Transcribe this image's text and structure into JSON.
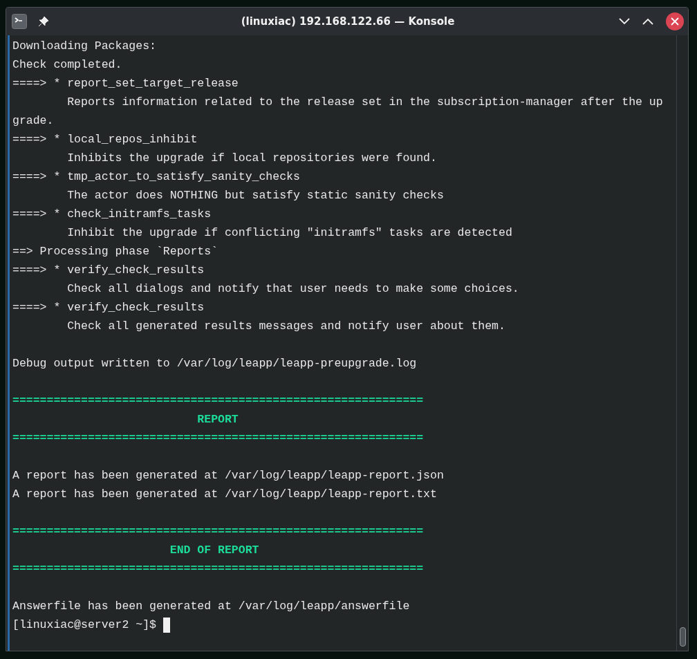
{
  "window": {
    "title": "(linuxiac) 192.168.122.66 — Konsole"
  },
  "lines": [
    {
      "kind": "output",
      "text": "Downloading Packages:"
    },
    {
      "kind": "output",
      "text": "Check completed."
    },
    {
      "kind": "output",
      "text": "====> * report_set_target_release"
    },
    {
      "kind": "output",
      "text": "        Reports information related to the release set in the subscription-manager after the up"
    },
    {
      "kind": "output",
      "text": "grade."
    },
    {
      "kind": "output",
      "text": "====> * local_repos_inhibit"
    },
    {
      "kind": "output",
      "text": "        Inhibits the upgrade if local repositories were found."
    },
    {
      "kind": "output",
      "text": "====> * tmp_actor_to_satisfy_sanity_checks"
    },
    {
      "kind": "output",
      "text": "        The actor does NOTHING but satisfy static sanity checks"
    },
    {
      "kind": "output",
      "text": "====> * check_initramfs_tasks"
    },
    {
      "kind": "output",
      "text": "        Inhibit the upgrade if conflicting \"initramfs\" tasks are detected"
    },
    {
      "kind": "output",
      "text": "==> Processing phase `Reports`"
    },
    {
      "kind": "output",
      "text": "====> * verify_check_results"
    },
    {
      "kind": "output",
      "text": "        Check all dialogs and notify that user needs to make some choices."
    },
    {
      "kind": "output",
      "text": "====> * verify_check_results"
    },
    {
      "kind": "output",
      "text": "        Check all generated results messages and notify user about them."
    },
    {
      "kind": "blank"
    },
    {
      "kind": "output",
      "text": "Debug output written to /var/log/leapp/leapp-preupgrade.log"
    },
    {
      "kind": "blank"
    },
    {
      "kind": "highlight",
      "text": "============================================================"
    },
    {
      "kind": "highlight",
      "text": "                           REPORT"
    },
    {
      "kind": "highlight",
      "text": "============================================================"
    },
    {
      "kind": "blank"
    },
    {
      "kind": "output",
      "text": "A report has been generated at /var/log/leapp/leapp-report.json"
    },
    {
      "kind": "output",
      "text": "A report has been generated at /var/log/leapp/leapp-report.txt"
    },
    {
      "kind": "blank"
    },
    {
      "kind": "highlight",
      "text": "============================================================"
    },
    {
      "kind": "highlight",
      "text": "                       END OF REPORT"
    },
    {
      "kind": "highlight",
      "text": "============================================================"
    },
    {
      "kind": "blank"
    },
    {
      "kind": "output",
      "text": "Answerfile has been generated at /var/log/leapp/answerfile"
    }
  ],
  "prompt": {
    "text": "[linuxiac@server2 ~]$ "
  }
}
